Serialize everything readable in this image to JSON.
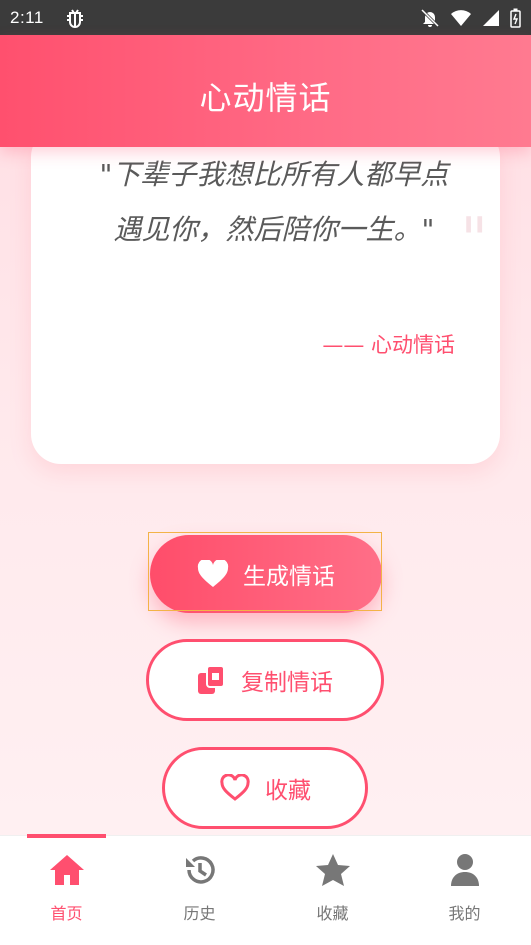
{
  "status_bar": {
    "time": "2:11",
    "icons": [
      "bug-icon",
      "notification-off-icon",
      "wifi-icon",
      "signal-icon",
      "battery-icon"
    ]
  },
  "header": {
    "title": "心动情话"
  },
  "quote": {
    "text": "\"下辈子我想比所有人都早点遇见你，然后陪你一生。\"",
    "author": "—— 心动情话"
  },
  "buttons": {
    "generate": "生成情话",
    "copy": "复制情话",
    "favorite": "收藏"
  },
  "nav": [
    {
      "label": "首页",
      "icon": "home-icon",
      "active": true
    },
    {
      "label": "历史",
      "icon": "history-icon",
      "active": false
    },
    {
      "label": "收藏",
      "icon": "star-icon",
      "active": false
    },
    {
      "label": "我的",
      "icon": "person-icon",
      "active": false
    }
  ],
  "colors": {
    "accent": "#ff4f6f",
    "header_gradient_start": "#ff506e",
    "header_gradient_end": "#ff7a90",
    "background": "#ffe9ec",
    "inactive_nav": "#777777"
  }
}
